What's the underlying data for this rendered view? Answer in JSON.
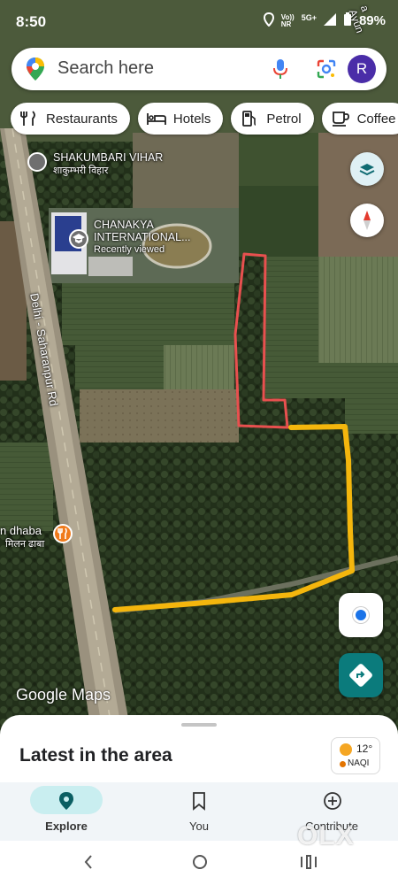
{
  "status": {
    "time": "8:50",
    "network": "Vo))\nNR",
    "signal": "5G+",
    "battery": "89%"
  },
  "search": {
    "placeholder": "Search here",
    "avatar_letter": "R"
  },
  "chips": [
    {
      "label": "Restaurants",
      "icon": "fork-knife-icon"
    },
    {
      "label": "Hotels",
      "icon": "bed-icon"
    },
    {
      "label": "Petrol",
      "icon": "fuel-pump-icon"
    },
    {
      "label": "Coffee",
      "icon": "coffee-cup-icon"
    }
  ],
  "map": {
    "labels": {
      "shakumbari_en": "SHAKUMBARI VIHAR",
      "shakumbari_hi": "शाकुम्भरी विहार",
      "school_en": "CHANAKYA",
      "school_en2": "INTERNATIONAL...",
      "school_sub": "Recently viewed",
      "road": "Delhi - Saharanpur Rd",
      "dhaba_en": "n dhaba",
      "dhaba_hi": "मिलन ढाबा",
      "corner_road": "a Ayun"
    },
    "attribution": "Google Maps"
  },
  "colors": {
    "red_outline": "#e8504f",
    "yellow_path": "#f4b60d",
    "brand_teal": "#0b7b7c"
  },
  "sheet": {
    "title": "Latest in the area",
    "weather_temp": "12°",
    "weather_aqi": "NAQI"
  },
  "bottom_nav": [
    {
      "label": "Explore",
      "icon": "explore-pin-icon",
      "active": true
    },
    {
      "label": "You",
      "icon": "bookmark-icon",
      "active": false
    },
    {
      "label": "Contribute",
      "icon": "add-circle-icon",
      "active": false
    }
  ],
  "watermark": "OLX"
}
